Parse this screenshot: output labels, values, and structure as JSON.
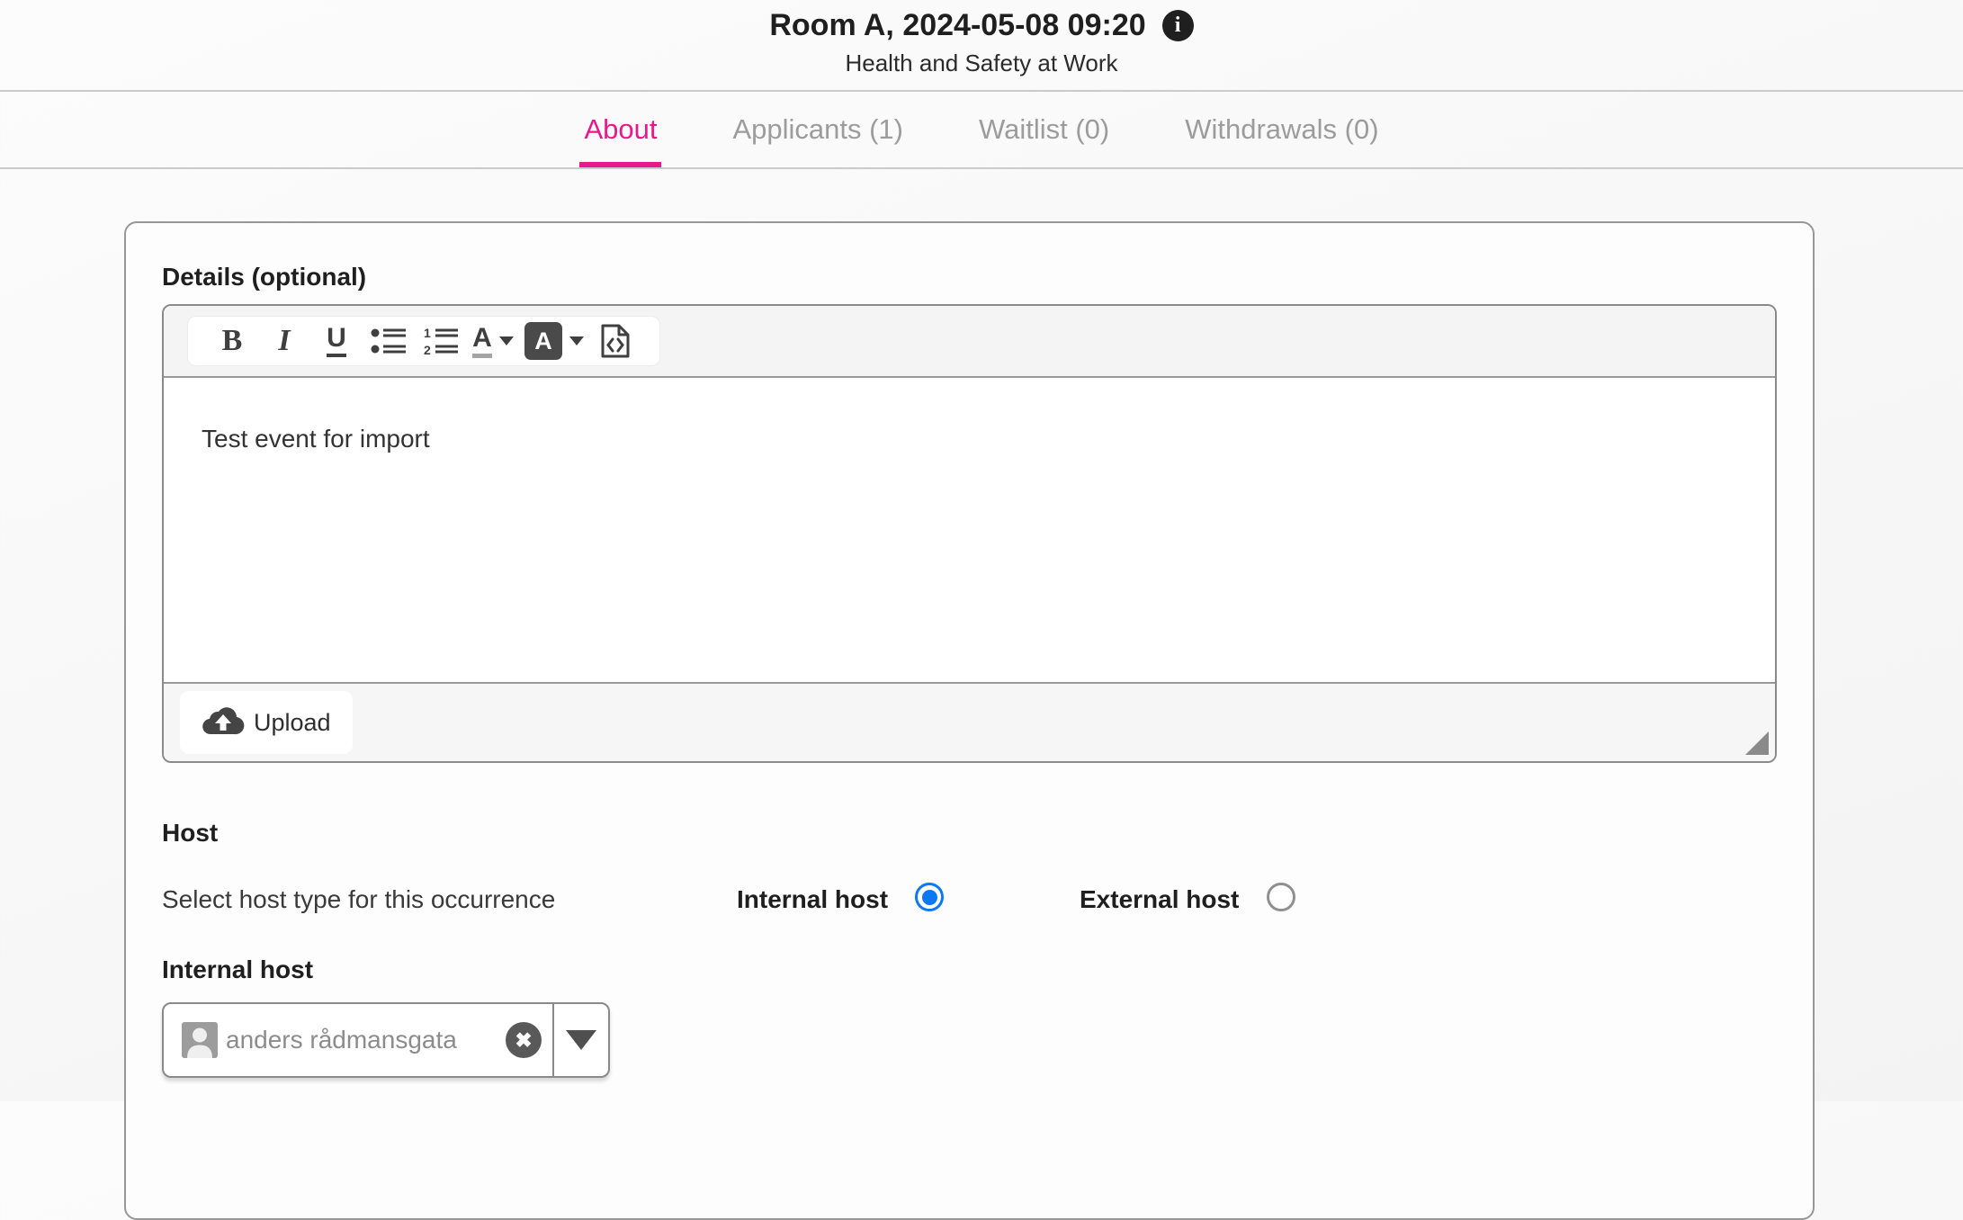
{
  "header": {
    "title": "Room A, 2024-05-08 09:20",
    "subtitle": "Health and Safety at Work",
    "info_icon": "info-circle-icon"
  },
  "tabs": [
    {
      "label": "About",
      "active": true
    },
    {
      "label": "Applicants (1)",
      "active": false
    },
    {
      "label": "Waitlist (0)",
      "active": false
    },
    {
      "label": "Withdrawals (0)",
      "active": false
    }
  ],
  "details": {
    "label": "Details (optional)",
    "toolbar_icons": [
      "bold",
      "italic",
      "underline",
      "bulleted-list",
      "numbered-list",
      "font-color",
      "background-color",
      "view-source"
    ],
    "content": "Test event for import",
    "upload_label": "Upload"
  },
  "host": {
    "heading": "Host",
    "select_type_label": "Select host type for this occurrence",
    "options": [
      {
        "label": "Internal host",
        "selected": true
      },
      {
        "label": "External host",
        "selected": false
      }
    ],
    "internal_host_label": "Internal host",
    "selected_host": "anders rådmansgata",
    "remove_icon": "x",
    "avatar_icon": "person"
  },
  "colors": {
    "accent_pink": "#e61a8c",
    "radio_blue": "#0c78f2"
  }
}
